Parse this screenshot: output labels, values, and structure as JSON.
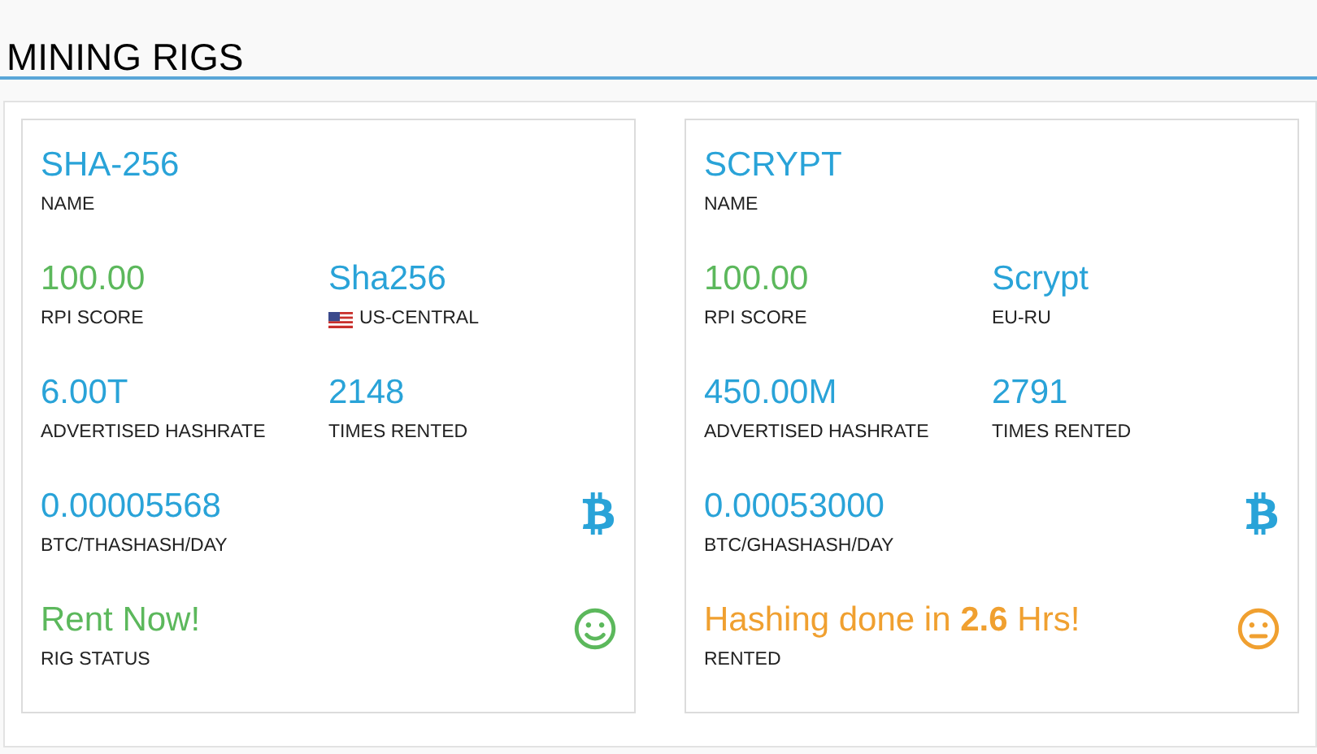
{
  "page_title": "MINING RIGS",
  "rigs": [
    {
      "name": "SHA-256",
      "name_label": "NAME",
      "rpi_score": "100.00",
      "rpi_label": "RPI SCORE",
      "algorithm": "Sha256",
      "region": "US-CENTRAL",
      "region_flag": true,
      "hashrate": "6.00T",
      "hashrate_label": "ADVERTISED HASHRATE",
      "times_rented": "2148",
      "times_rented_label": "TIMES RENTED",
      "price": "0.00005568",
      "price_label": "BTC/THASHASH/DAY",
      "status": {
        "kind": "available",
        "text": "Rent Now!",
        "label": "RIG STATUS"
      }
    },
    {
      "name": "SCRYPT",
      "name_label": "NAME",
      "rpi_score": "100.00",
      "rpi_label": "RPI SCORE",
      "algorithm": "Scrypt",
      "region": "EU-RU",
      "region_flag": false,
      "hashrate": "450.00M",
      "hashrate_label": "ADVERTISED HASHRATE",
      "times_rented": "2791",
      "times_rented_label": "TIMES RENTED",
      "price": "0.00053000",
      "price_label": "BTC/GHASHASH/DAY",
      "status": {
        "kind": "rented",
        "text": "Hashing done in **2.6** Hrs!",
        "label": "RENTED"
      }
    }
  ]
}
